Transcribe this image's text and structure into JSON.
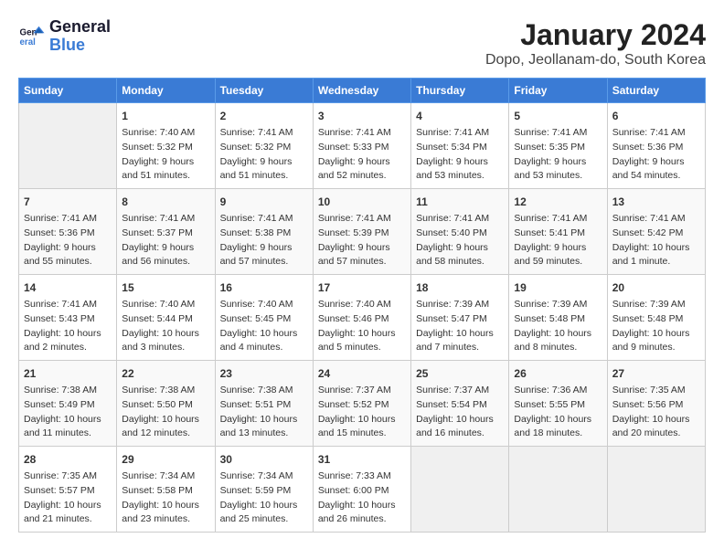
{
  "logo": {
    "line1": "General",
    "line2": "Blue"
  },
  "title": "January 2024",
  "subtitle": "Dopo, Jeollanam-do, South Korea",
  "days_of_week": [
    "Sunday",
    "Monday",
    "Tuesday",
    "Wednesday",
    "Thursday",
    "Friday",
    "Saturday"
  ],
  "weeks": [
    [
      {
        "day": "",
        "info": ""
      },
      {
        "day": "1",
        "info": "Sunrise: 7:40 AM\nSunset: 5:32 PM\nDaylight: 9 hours\nand 51 minutes."
      },
      {
        "day": "2",
        "info": "Sunrise: 7:41 AM\nSunset: 5:32 PM\nDaylight: 9 hours\nand 51 minutes."
      },
      {
        "day": "3",
        "info": "Sunrise: 7:41 AM\nSunset: 5:33 PM\nDaylight: 9 hours\nand 52 minutes."
      },
      {
        "day": "4",
        "info": "Sunrise: 7:41 AM\nSunset: 5:34 PM\nDaylight: 9 hours\nand 53 minutes."
      },
      {
        "day": "5",
        "info": "Sunrise: 7:41 AM\nSunset: 5:35 PM\nDaylight: 9 hours\nand 53 minutes."
      },
      {
        "day": "6",
        "info": "Sunrise: 7:41 AM\nSunset: 5:36 PM\nDaylight: 9 hours\nand 54 minutes."
      }
    ],
    [
      {
        "day": "7",
        "info": "Sunrise: 7:41 AM\nSunset: 5:36 PM\nDaylight: 9 hours\nand 55 minutes."
      },
      {
        "day": "8",
        "info": "Sunrise: 7:41 AM\nSunset: 5:37 PM\nDaylight: 9 hours\nand 56 minutes."
      },
      {
        "day": "9",
        "info": "Sunrise: 7:41 AM\nSunset: 5:38 PM\nDaylight: 9 hours\nand 57 minutes."
      },
      {
        "day": "10",
        "info": "Sunrise: 7:41 AM\nSunset: 5:39 PM\nDaylight: 9 hours\nand 57 minutes."
      },
      {
        "day": "11",
        "info": "Sunrise: 7:41 AM\nSunset: 5:40 PM\nDaylight: 9 hours\nand 58 minutes."
      },
      {
        "day": "12",
        "info": "Sunrise: 7:41 AM\nSunset: 5:41 PM\nDaylight: 9 hours\nand 59 minutes."
      },
      {
        "day": "13",
        "info": "Sunrise: 7:41 AM\nSunset: 5:42 PM\nDaylight: 10 hours\nand 1 minute."
      }
    ],
    [
      {
        "day": "14",
        "info": "Sunrise: 7:41 AM\nSunset: 5:43 PM\nDaylight: 10 hours\nand 2 minutes."
      },
      {
        "day": "15",
        "info": "Sunrise: 7:40 AM\nSunset: 5:44 PM\nDaylight: 10 hours\nand 3 minutes."
      },
      {
        "day": "16",
        "info": "Sunrise: 7:40 AM\nSunset: 5:45 PM\nDaylight: 10 hours\nand 4 minutes."
      },
      {
        "day": "17",
        "info": "Sunrise: 7:40 AM\nSunset: 5:46 PM\nDaylight: 10 hours\nand 5 minutes."
      },
      {
        "day": "18",
        "info": "Sunrise: 7:39 AM\nSunset: 5:47 PM\nDaylight: 10 hours\nand 7 minutes."
      },
      {
        "day": "19",
        "info": "Sunrise: 7:39 AM\nSunset: 5:48 PM\nDaylight: 10 hours\nand 8 minutes."
      },
      {
        "day": "20",
        "info": "Sunrise: 7:39 AM\nSunset: 5:48 PM\nDaylight: 10 hours\nand 9 minutes."
      }
    ],
    [
      {
        "day": "21",
        "info": "Sunrise: 7:38 AM\nSunset: 5:49 PM\nDaylight: 10 hours\nand 11 minutes."
      },
      {
        "day": "22",
        "info": "Sunrise: 7:38 AM\nSunset: 5:50 PM\nDaylight: 10 hours\nand 12 minutes."
      },
      {
        "day": "23",
        "info": "Sunrise: 7:38 AM\nSunset: 5:51 PM\nDaylight: 10 hours\nand 13 minutes."
      },
      {
        "day": "24",
        "info": "Sunrise: 7:37 AM\nSunset: 5:52 PM\nDaylight: 10 hours\nand 15 minutes."
      },
      {
        "day": "25",
        "info": "Sunrise: 7:37 AM\nSunset: 5:54 PM\nDaylight: 10 hours\nand 16 minutes."
      },
      {
        "day": "26",
        "info": "Sunrise: 7:36 AM\nSunset: 5:55 PM\nDaylight: 10 hours\nand 18 minutes."
      },
      {
        "day": "27",
        "info": "Sunrise: 7:35 AM\nSunset: 5:56 PM\nDaylight: 10 hours\nand 20 minutes."
      }
    ],
    [
      {
        "day": "28",
        "info": "Sunrise: 7:35 AM\nSunset: 5:57 PM\nDaylight: 10 hours\nand 21 minutes."
      },
      {
        "day": "29",
        "info": "Sunrise: 7:34 AM\nSunset: 5:58 PM\nDaylight: 10 hours\nand 23 minutes."
      },
      {
        "day": "30",
        "info": "Sunrise: 7:34 AM\nSunset: 5:59 PM\nDaylight: 10 hours\nand 25 minutes."
      },
      {
        "day": "31",
        "info": "Sunrise: 7:33 AM\nSunset: 6:00 PM\nDaylight: 10 hours\nand 26 minutes."
      },
      {
        "day": "",
        "info": ""
      },
      {
        "day": "",
        "info": ""
      },
      {
        "day": "",
        "info": ""
      }
    ]
  ]
}
